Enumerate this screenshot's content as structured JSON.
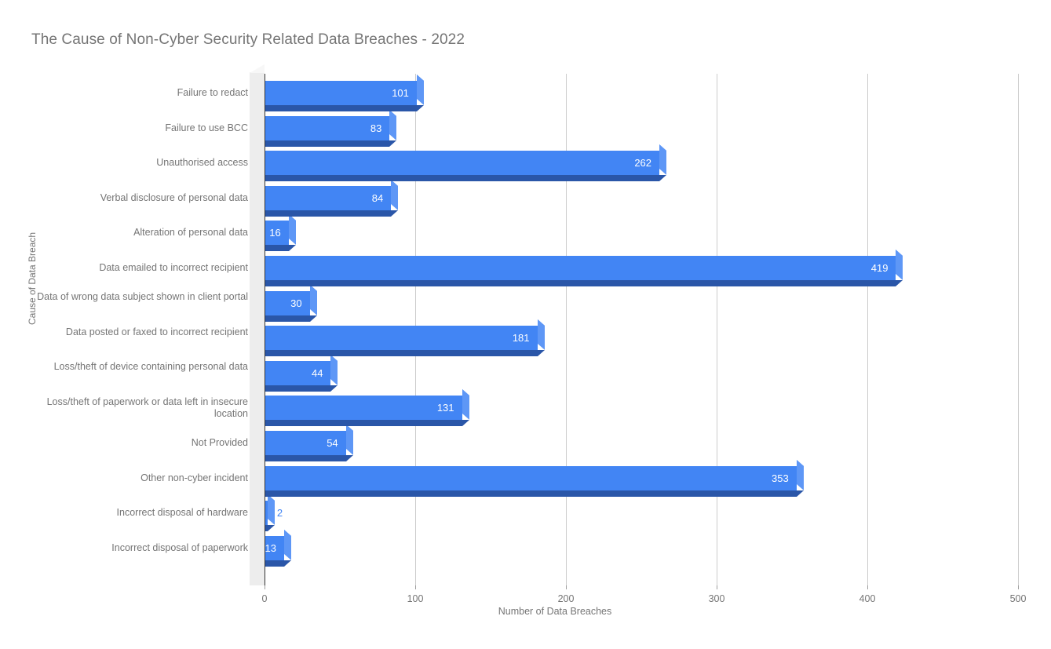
{
  "chart_data": {
    "type": "bar",
    "orientation": "horizontal",
    "title": "The Cause of Non-Cyber Security Related Data Breaches - 2022",
    "xlabel": "Number of Data Breaches",
    "ylabel": "Cause of Data Breach",
    "xlim": [
      0,
      500
    ],
    "xticks": [
      0,
      100,
      200,
      300,
      400,
      500
    ],
    "grid": "vertical",
    "legend": "none",
    "bar_color": "#4285F4",
    "bar_side_color": "#5E97F6",
    "bar_base_color": "#2A56A8",
    "categories": [
      "Failure to redact",
      "Failure to use BCC",
      "Unauthorised access",
      "Verbal disclosure of personal data",
      "Alteration of personal data",
      "Data emailed to incorrect recipient",
      "Data of wrong data subject shown in client portal",
      "Data posted or faxed to incorrect recipient",
      "Loss/theft of device containing personal data",
      "Loss/theft of paperwork or data left in insecure location",
      "Not Provided",
      "Other non-cyber incident",
      "Incorrect disposal of hardware",
      "Incorrect disposal of paperwork"
    ],
    "values": [
      101,
      83,
      262,
      84,
      16,
      419,
      30,
      181,
      44,
      131,
      54,
      353,
      2,
      13
    ],
    "labels": [
      "101",
      "83",
      "262",
      "84",
      "16",
      "419",
      "30",
      "181",
      "44",
      "131",
      "54",
      "353",
      "2",
      "13"
    ],
    "label_placement": [
      "inside",
      "inside",
      "inside",
      "inside",
      "inside",
      "inside",
      "inside",
      "inside",
      "inside",
      "inside",
      "inside",
      "inside",
      "outside",
      "inside"
    ],
    "xtick_labels": [
      "0",
      "100",
      "200",
      "300",
      "400",
      "500"
    ]
  }
}
